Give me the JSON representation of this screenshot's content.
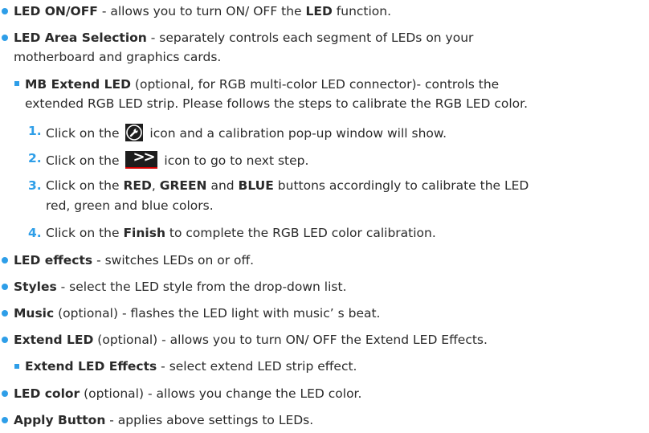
{
  "items": {
    "led_onoff": {
      "term": "LED ON/OFF",
      "desc_a": " - allows you to turn ON/ OFF the ",
      "term2": "LED",
      "desc_b": " function."
    },
    "area": {
      "term": "LED Area Selection",
      "desc_a": " - separately controls each segment of LEDs on your",
      "desc_b": "motherboard and graphics cards."
    },
    "mb_extend": {
      "term": "MB Extend LED",
      "desc_a": " (optional, for RGB multi-color LED connector)- controls the",
      "desc_b": "extended RGB LED strip. Please follows the steps to calibrate the RGB LED color."
    },
    "steps": [
      {
        "num": "1.",
        "pre": "Click on the ",
        "post": " icon and a calibration pop-up window will show."
      },
      {
        "num": "2.",
        "pre": "Click on the ",
        "post": " icon to go to next step."
      },
      {
        "num": "3.",
        "pre": "Click on the ",
        "red": "RED",
        "sep1": ", ",
        "green": "GREEN",
        "sep2": " and ",
        "blue": "BLUE",
        "post": " buttons accordingly to calibrate the LED",
        "cont": "red, green and blue colors."
      },
      {
        "num": "4.",
        "pre": "Click on the ",
        "finish": "Finish",
        "post": " to complete the RGB LED color calibration."
      }
    ],
    "effects": {
      "term": "LED effects",
      "desc": " - switches LEDs on or off."
    },
    "styles": {
      "term": "Styles",
      "desc": " - select the LED style from the drop-down list."
    },
    "music": {
      "term": "Music",
      "desc": " (optional) - flashes the LED light with music’ s beat."
    },
    "extend": {
      "term": "Extend LED",
      "desc": " (optional) - allows you to turn ON/ OFF the Extend LED Effects."
    },
    "extend_effects": {
      "term": "Extend LED Effects",
      "desc": " - select extend LED strip effect."
    },
    "color": {
      "term": "LED color",
      "desc": " (optional) - allows you change the LED color."
    },
    "apply": {
      "term": "Apply Button",
      "desc": " - applies above settings to LEDs."
    }
  },
  "icons": {
    "calibrate": "wrench-icon",
    "next": "double-chevron-right-icon",
    "accent": "#2e9ee8"
  }
}
